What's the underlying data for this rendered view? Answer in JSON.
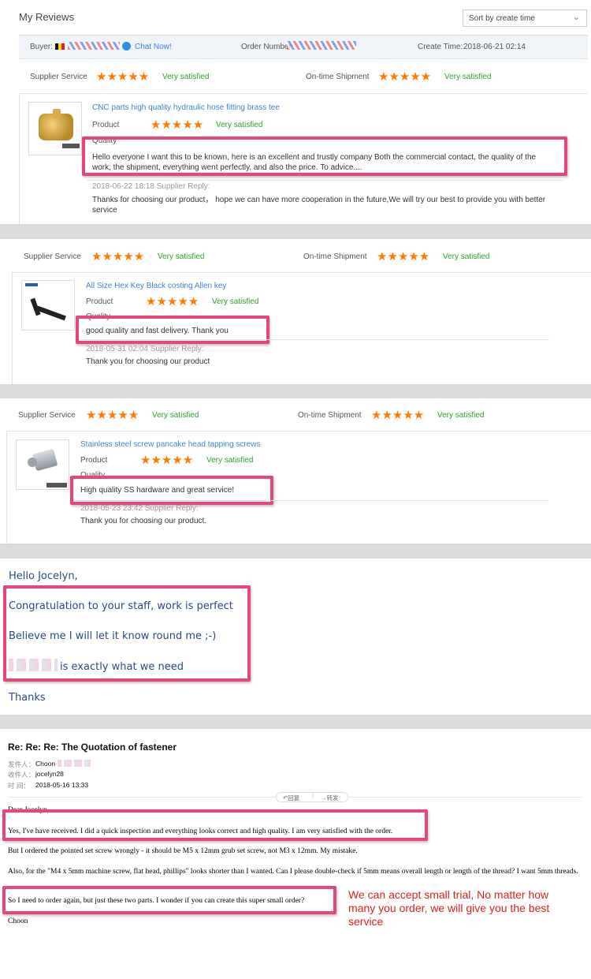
{
  "review1": {
    "title": "My Reviews",
    "sort_label": "Sort by create time",
    "buyer_label": "Buyer:",
    "chat_label": "Chat Now!",
    "order_label": "Order Number",
    "create_label": "Create Time:",
    "create_time": "2018-06-21 02:14",
    "supplier_service_label": "Supplier Service",
    "supplier_rating": "Very satisfied",
    "shipment_label": "On-time Shipment",
    "shipment_rating": "Very satisfied",
    "product_title": "CNC parts high quality hydraulic hose fitting brass tee",
    "product_label": "Product",
    "product_rating": "Very satisfied",
    "quality_label": "Quality",
    "review_text": "Hello everyone I want this to be known, here is an excellent and trustly company Both the commercial contact, the quality of the work, the shipment, everything went perfectly, and also the price. To advice....",
    "reply_meta": "2018-06-22 18:18  Supplier Reply:",
    "reply_text": "Thanks for choosing our product， hope we can have more cooperation in the future,We will try our best to provide you with better service"
  },
  "review2": {
    "supplier_service_label": "Supplier Service",
    "supplier_rating": "Very satisfied",
    "shipment_label": "On-time Shipment",
    "shipment_rating": "Very satisfied",
    "product_title": "All Size Hex Key Black costing Allen key",
    "product_label": "Product",
    "product_rating": "Very satisfied",
    "quality_label": "Quality",
    "review_text": "good quality and fast delivery. Thank you",
    "reply_meta": "2018-05-31 02:04  Supplier Reply:",
    "reply_text": "Thank you for choosing our product"
  },
  "review3": {
    "supplier_service_label": "Supplier Service",
    "supplier_rating": "Very satisfied",
    "shipment_label": "On-time Shipment",
    "shipment_rating": "Very satisfied",
    "product_title": "Stainless steel screw pancake head tapping screws",
    "product_label": "Product",
    "product_rating": "Very satisfied",
    "quality_label": "Quality",
    "review_text": "High quality SS hardware and great service!",
    "reply_meta": "2018-05-23 23:42  Supplier Reply:",
    "reply_text": "Thank you for choosing our product."
  },
  "letter": {
    "greeting": "Hello Jocelyn,",
    "line1": "Congratulation to your staff, work is perfect",
    "line2": "Believe me I will let it know round  me ;-)",
    "line3": "is exactly what we need",
    "closing": "Thanks"
  },
  "email": {
    "subject": "Re: Re: Re: The Quotation of fastener",
    "from_label": "发件人：",
    "from_value": "Choon",
    "to_label": "收件人：",
    "to_value": "jocelyn28",
    "time_label": "时   间：",
    "time_value": "2018-05-16  13:33",
    "reply_btn": "回复",
    "forward_btn": "转发",
    "salutation": "Dear Jocelyn,",
    "p1": "Yes, I've have received. I did a quick inspection and everything looks correct and high quality. I am very satisfied with the order.",
    "p2": "But I ordered the pointed set screw wrongly - it should be M5 x 12mm grub set screw, not M3 x 12mm. My mistake.",
    "p3": "Also, for the \"M4 x 5mm machine screw, flat head, phillips\" looks shorter than I wanted. Can I please double-check if 5mm means overall length or length of the thread? I want 5mm threads.",
    "p4": "So I need to order again, but just these two parts. I wonder if you can create this super small order?",
    "signoff": "Choon",
    "note": "We can accept small trial, No matter how many you order, we will give you the best service"
  },
  "stars": "★★★★★",
  "colors": {
    "accent_pink": "#e6467c",
    "star_orange": "#ff7a00",
    "link_blue": "#3e84d8",
    "satisfied_green": "#2fa12f",
    "note_red": "#e02020"
  }
}
